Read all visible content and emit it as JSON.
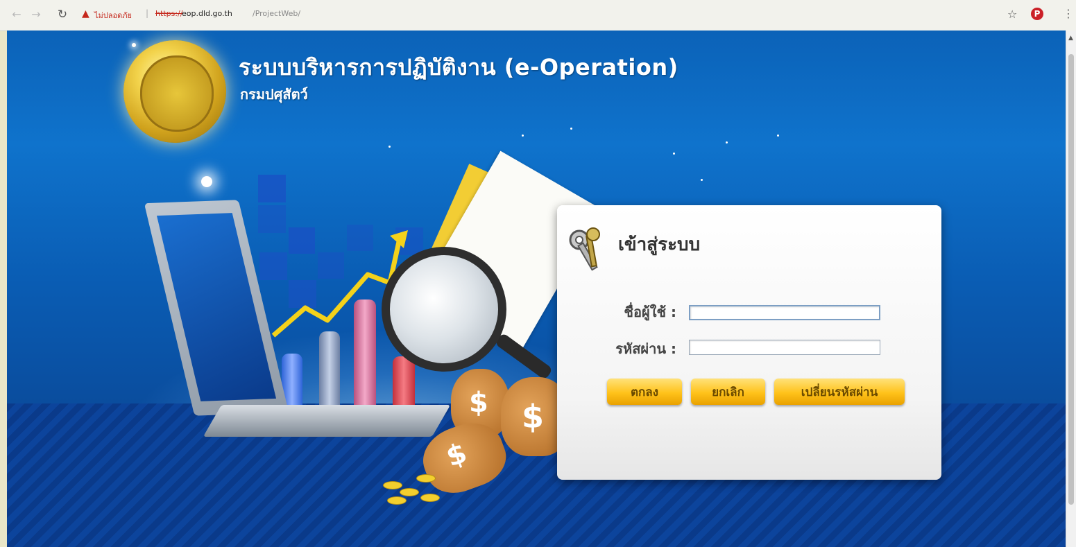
{
  "browser": {
    "security_text": "ไม่ปลอดภัย",
    "url_scheme": "https://",
    "url_host": "eop.dld.go.th",
    "url_path": "/ProjectWeb/"
  },
  "header": {
    "title": "ระบบบริหารการปฏิบัติงาน (e-Operation)",
    "subtitle": "กรมปศุสัตว์"
  },
  "login": {
    "title": "เข้าสู่ระบบ",
    "username_label": "ชื่อผู้ใช้ :",
    "username_value": "",
    "password_label": "รหัสผ่าน :",
    "password_value": "",
    "ok_button": "ตกลง",
    "cancel_button": "ยกเลิก",
    "change_password_button": "เปลี่ยนรหัสผ่าน"
  },
  "icons": {
    "emblem": "gold-emblem-icon",
    "keys": "keys-icon",
    "star": "star-icon",
    "menu": "kebab-menu-icon"
  }
}
